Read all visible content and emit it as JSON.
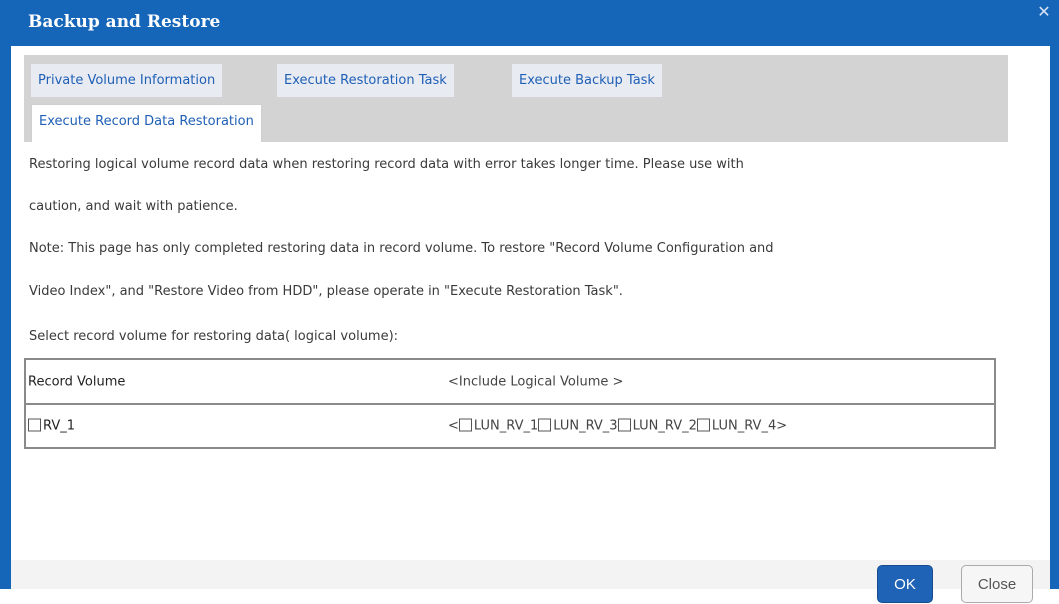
{
  "dialog": {
    "title": "Backup and Restore",
    "close_icon": "close-icon",
    "close_glyph": "✕"
  },
  "tabs": [
    {
      "label": "Private Volume Information",
      "active": false
    },
    {
      "label": "Execute Restoration Task",
      "active": false
    },
    {
      "label": "Execute Backup Task",
      "active": false
    },
    {
      "label": "Execute Record Data Restoration",
      "active": true
    }
  ],
  "content": {
    "warning_line1": "Restoring logical volume record data when restoring record data with error takes longer time. Please use with",
    "warning_line2": "caution, and wait with patience.",
    "note_line1": "Note: This page has only completed restoring data in record volume. To restore \"Record Volume Configuration and",
    "note_line2": "Video Index\", and \"Restore Video from HDD\", please operate in \"Execute Restoration Task\".",
    "select_prompt": "Select record volume for restoring data( logical volume):"
  },
  "table": {
    "header_col1": "Record Volume",
    "header_col2": "<Include Logical Volume >",
    "row": {
      "volume": "RV_1",
      "open_bracket": "<",
      "luns": [
        "LUN_RV_1",
        "LUN_RV_3",
        "LUN_RV_2",
        "LUN_RV_4"
      ],
      "close_bracket": ">"
    }
  },
  "buttons": {
    "ok": "OK",
    "close": "Close"
  },
  "colors": {
    "title_bar": "#1565b8",
    "tab_text": "#1f5fb6",
    "ok_button": "#1f63b6"
  }
}
